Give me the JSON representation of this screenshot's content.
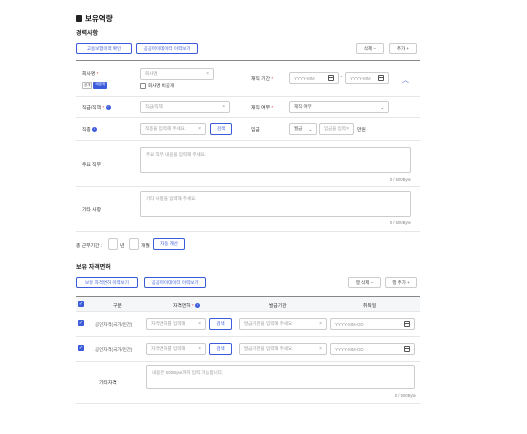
{
  "page": {
    "title": "보유역량"
  },
  "career": {
    "section_title": "경력사항",
    "btn_insurance": "고용보험이력 확인",
    "btn_mydata": "공공마이데이터 이력보기",
    "btn_delete": "삭제 −",
    "btn_add": "추가 +",
    "company_label": "회사명",
    "company_placeholder": "회사명",
    "tag_private": "공개",
    "tag_nonpublic": "비공개",
    "company_private_checkbox": "회사명 비공개",
    "period_label": "재직 기간",
    "date_placeholder": "YYYY-MM",
    "date_sep": "~",
    "position_label": "직급/직책",
    "position_placeholder": "직급/직책",
    "employment_label": "재직 여부",
    "employment_value": "재직 여부",
    "job_label": "직종",
    "job_placeholder": "직종을 입력해 주세요.",
    "job_search_btn": "검색",
    "salary_label": "임금",
    "salary_type": "월급",
    "salary_placeholder": "임금을 입력",
    "salary_unit": "만원",
    "duties_label": "주요 직무",
    "duties_placeholder": "주요 직무 내용을 입력해 주세요.",
    "duties_count": "0 / 500Byte",
    "other_label": "기타 사항",
    "other_placeholder": "기타 사항을 입력해 주세요.",
    "other_count": "0 / 500Byte",
    "total_label": "총 근무기간 :",
    "total_year": "년",
    "total_month": "개월",
    "auto_calc_btn": "자동 계산"
  },
  "cert": {
    "section_title": "보유 자격면허",
    "btn_qnet": "보유 자격면허 이력보기",
    "btn_mydata": "공공마이데이터 이력보기",
    "btn_row_delete": "행 삭제 −",
    "btn_row_add": "행 추가 +",
    "col_type": "구분",
    "col_license": "자격면허",
    "col_issuer": "발급기관",
    "col_date": "취득일",
    "rows": [
      {
        "type": "공인자격(국가/민간)",
        "license_placeholder": "자격면허를 입력해",
        "search_btn": "검색",
        "issuer_placeholder": "발급기관을 입력해 주세요.",
        "date_placeholder": "YYYY-MM-DD"
      },
      {
        "type": "공인자격(국가/민간)",
        "license_placeholder": "자격면허를 입력해",
        "search_btn": "검색",
        "issuer_placeholder": "발급기관을 입력해 주세요.",
        "date_placeholder": "YYYY-MM-DD"
      }
    ],
    "other_label": "기타자격",
    "other_placeholder": "내용은 500Byte까지 입력 가능합니다.",
    "other_count": "0 / 500Byte"
  },
  "colors": {
    "accent": "#3b5bdb",
    "required": "#e03131"
  }
}
